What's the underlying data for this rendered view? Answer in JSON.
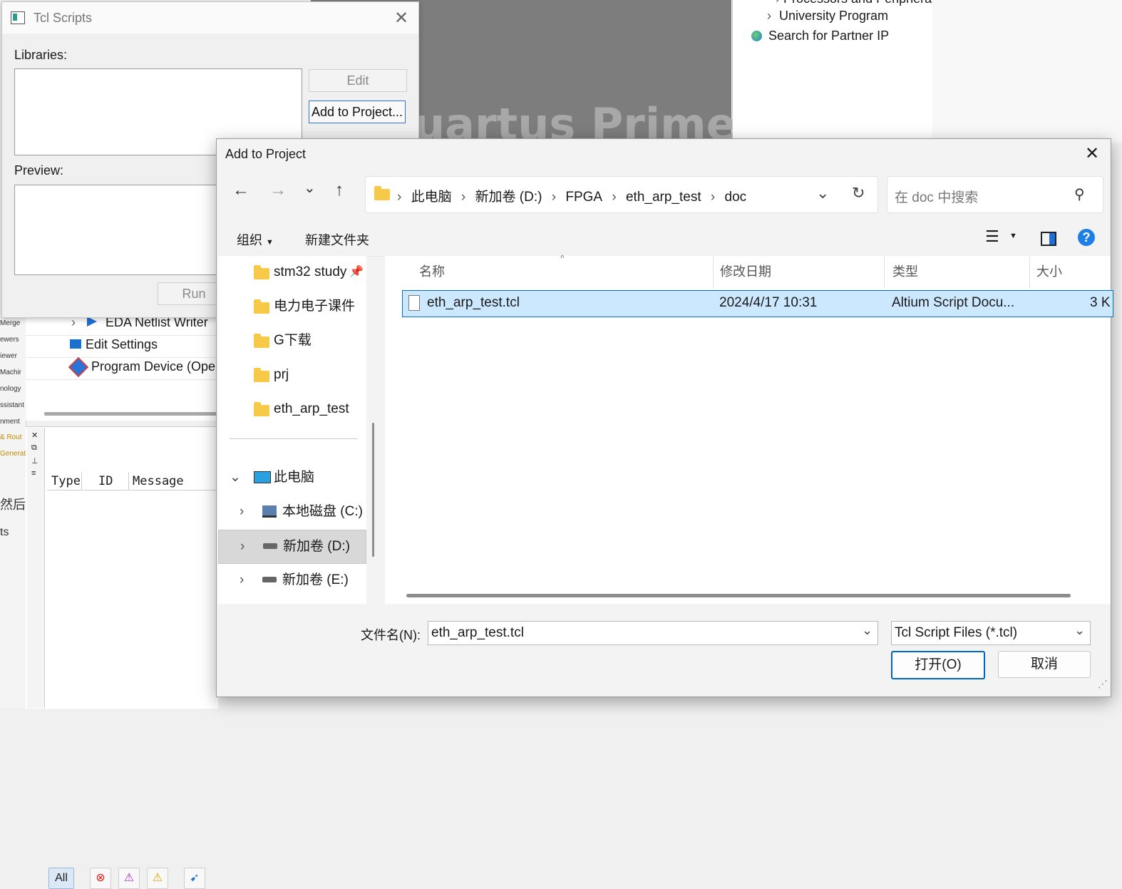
{
  "background": {
    "left_strip_items": [
      "Merge",
      "ewers",
      "iewer",
      "Machir",
      "nology",
      "ssistant",
      "nment",
      "& Rout",
      "Generat",
      "然后",
      "ts"
    ],
    "tasks": [
      "EDA Netlist Writer",
      "Edit Settings",
      "Program Device (Open"
    ],
    "splash_text": "uartus Prime",
    "ip_catalog": {
      "partial_item": "Processors and Peripherals",
      "university_program": "University Program",
      "search_partner_ip": "Search for Partner IP"
    },
    "messages": {
      "filter_all": "All",
      "columns": [
        "Type",
        "ID",
        "Message"
      ]
    }
  },
  "tcl_dialog": {
    "title": "Tcl Scripts",
    "libraries_label": "Libraries:",
    "preview_label": "Preview:",
    "edit_button": "Edit",
    "add_to_project_button": "Add to Project...",
    "run_button": "Run"
  },
  "file_dialog": {
    "title": "Add to Project",
    "breadcrumb": [
      "此电脑",
      "新加卷 (D:)",
      "FPGA",
      "eth_arp_test",
      "doc"
    ],
    "search_placeholder": "在 doc 中搜索",
    "organize_label": "组织",
    "new_folder_label": "新建文件夹",
    "nav_quick_access": [
      "stm32 study",
      "电力电子课件",
      "G下载",
      "prj",
      "eth_arp_test"
    ],
    "nav_this_pc": "此电脑",
    "nav_drives": [
      "本地磁盘 (C:)",
      "新加卷 (D:)",
      "新加卷 (E:)"
    ],
    "columns": {
      "name": "名称",
      "modified": "修改日期",
      "type": "类型",
      "size": "大小"
    },
    "files": [
      {
        "name": "eth_arp_test.tcl",
        "modified": "2024/4/17 10:31",
        "type": "Altium Script Docu...",
        "size": "3 K"
      }
    ],
    "filename_label": "文件名(N):",
    "filename_value": "eth_arp_test.tcl",
    "filetype_value": "Tcl Script Files (*.tcl)",
    "open_button": "打开(O)",
    "cancel_button": "取消"
  },
  "colors": {
    "accent": "#0067c0",
    "selection": "#cce8ff",
    "folder": "#f7c948"
  }
}
